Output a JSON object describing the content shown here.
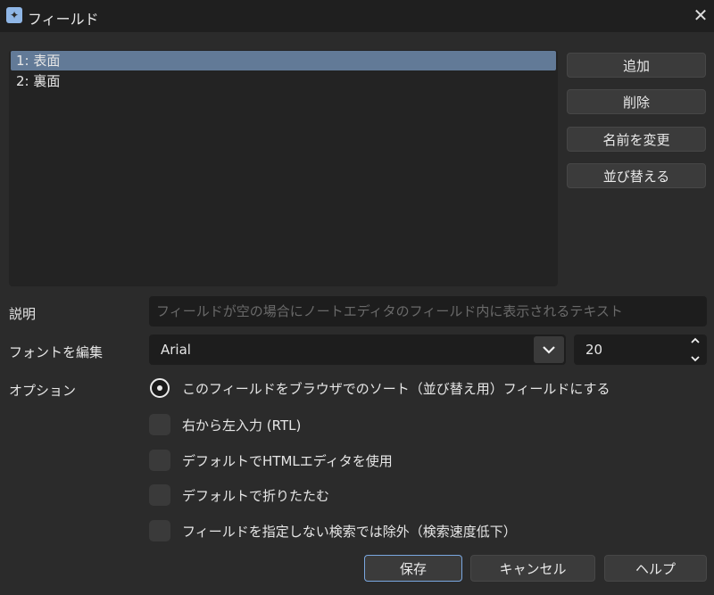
{
  "window": {
    "title": "フィールド"
  },
  "fields": [
    {
      "label": "1: 表面",
      "selected": true
    },
    {
      "label": "2: 裏面",
      "selected": false
    }
  ],
  "side_buttons": {
    "add": "追加",
    "delete": "削除",
    "rename": "名前を変更",
    "reorder": "並び替える"
  },
  "description": {
    "label": "説明",
    "placeholder": "フィールドが空の場合にノートエディタのフィールド内に表示されるテキスト"
  },
  "font": {
    "label": "フォントを編集",
    "family": "Arial",
    "size": "20"
  },
  "options": {
    "label": "オプション",
    "sort_field": "このフィールドをブラウザでのソート（並び替え用）フィールドにする",
    "rtl": "右から左入力 (RTL)",
    "html_editor": "デフォルトでHTMLエディタを使用",
    "collapse": "デフォルトで折りたたむ",
    "exclude_search": "フィールドを指定しない検索では除外（検索速度低下）"
  },
  "bottom_buttons": {
    "save": "保存",
    "cancel": "キャンセル",
    "help": "ヘルプ"
  },
  "colors": {
    "selection": "#627a97",
    "focus_border": "#7aa7e0",
    "background": "#2b2b2b"
  }
}
